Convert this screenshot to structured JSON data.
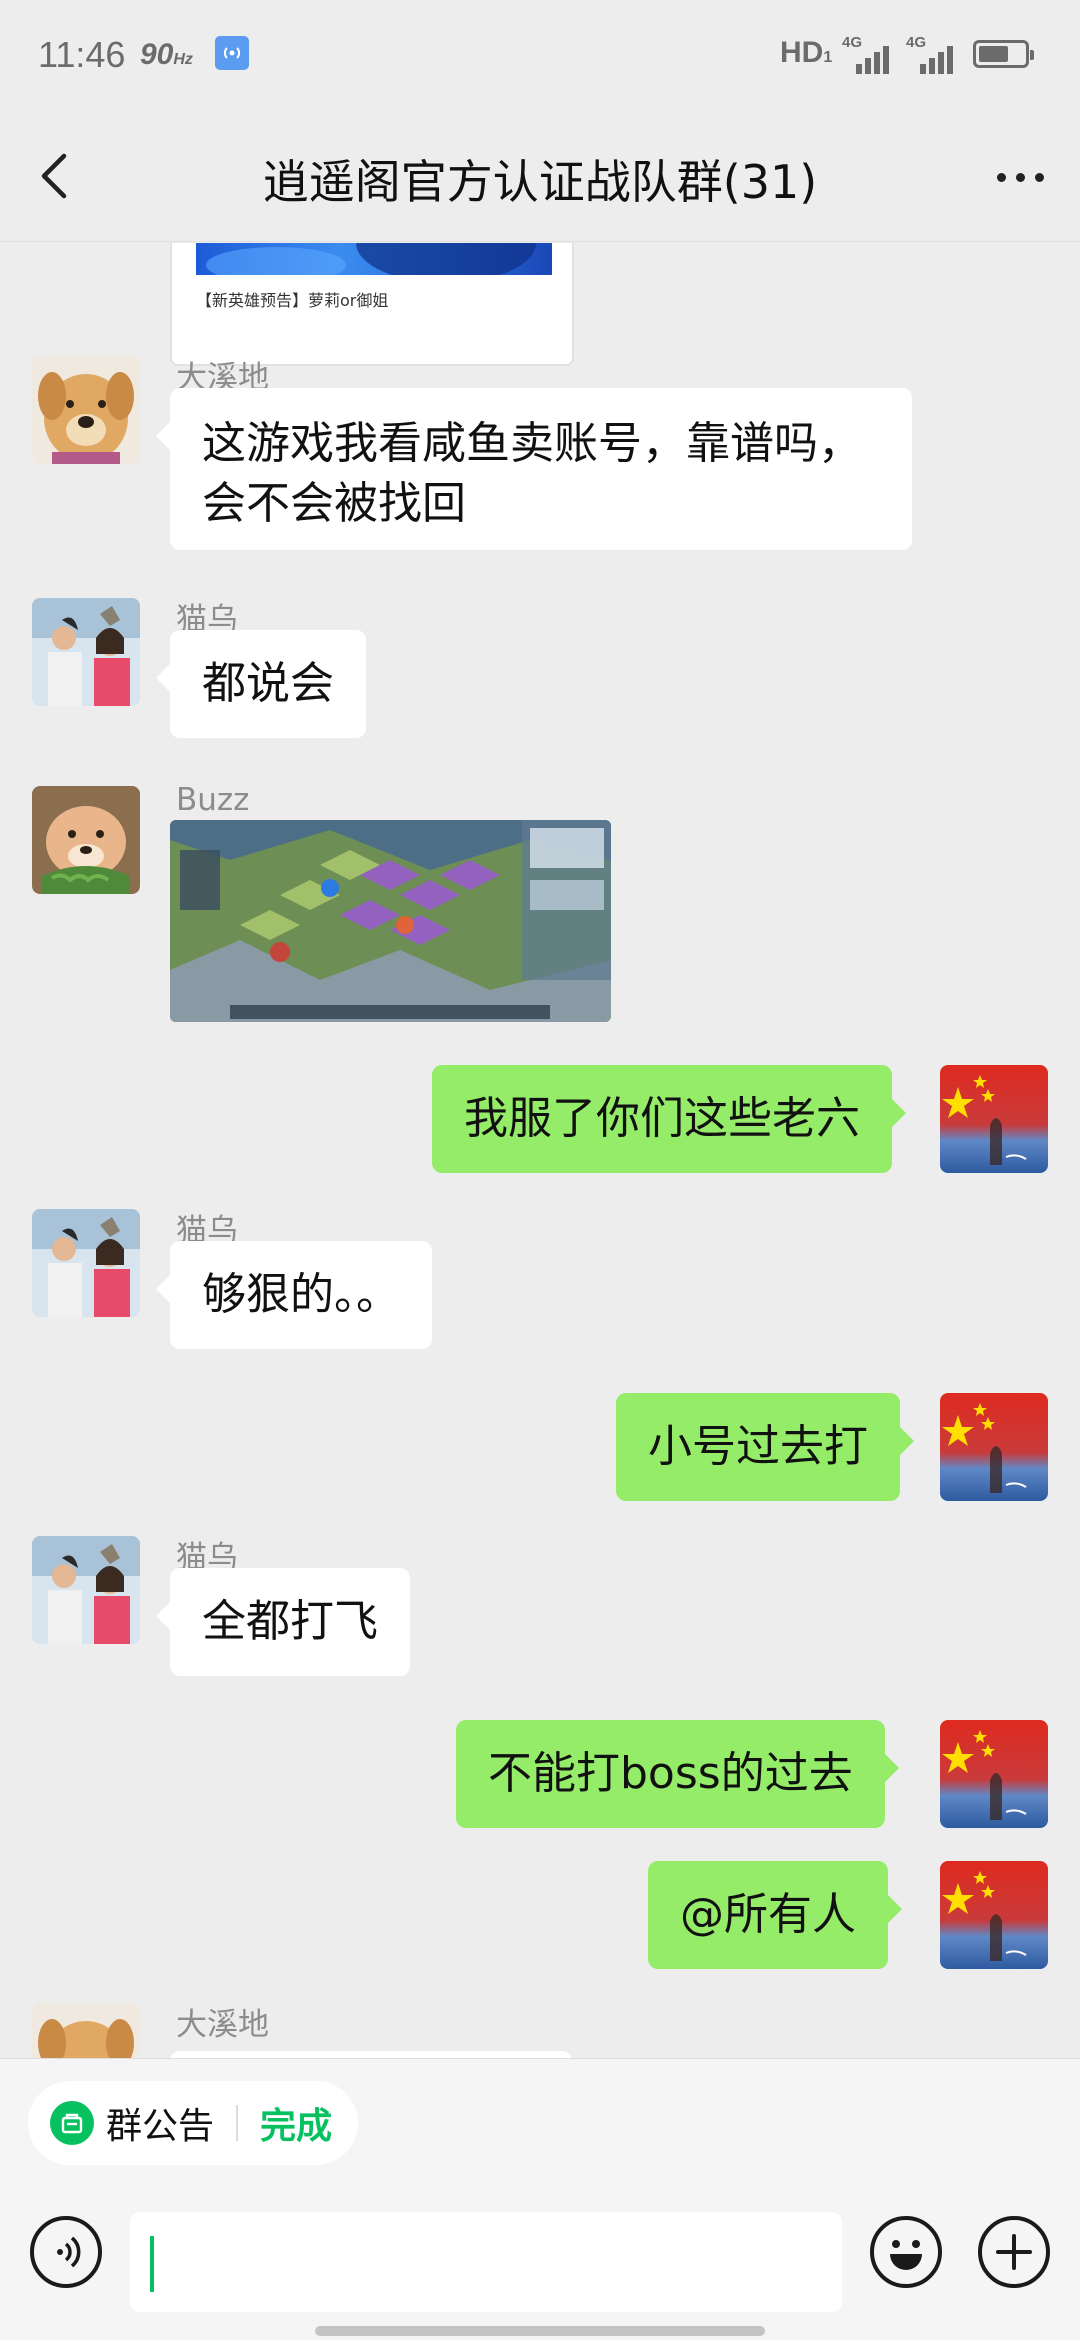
{
  "status_bar": {
    "time": "11:46",
    "refresh_rate": "90",
    "refresh_unit": "Hz",
    "hd_label": "HD",
    "hd_sub": "1",
    "network_1": "4G",
    "network_2": "4G",
    "battery_level": 0.65
  },
  "header": {
    "title": "逍遥阁官方认证战队群(31)",
    "back_icon": "chevron-left-icon",
    "more_icon": "more-dots-icon"
  },
  "messages": {
    "link_card_title": "【新英雄预告】萝莉or御姐",
    "m1_sender": "大溪地",
    "m1_text_line1": "这游戏我看咸鱼卖账号，靠谱吗，",
    "m1_text_line2": "会不会被找回",
    "m2_sender": "猫乌",
    "m2_text": "都说会",
    "m3_sender": "Buzz",
    "m4_text": "我服了你们这些老六",
    "m5_sender": "猫乌",
    "m5_text": "够狠的。。",
    "m6_text": "小号过去打",
    "m7_sender": "猫乌",
    "m7_text": "全都打飞",
    "m8_text": "不能打boss的过去",
    "m9_text": "@所有人",
    "m10_sender": "大溪地"
  },
  "notice": {
    "label": "群公告",
    "done": "完成",
    "accent": "#07c160"
  },
  "input": {
    "value": "",
    "voice_icon": "voice-icon",
    "emoji_icon": "emoji-icon",
    "plus_icon": "plus-icon"
  },
  "colors": {
    "background": "#ededed",
    "bubble_self": "#95ec69",
    "bubble_other": "#ffffff"
  }
}
